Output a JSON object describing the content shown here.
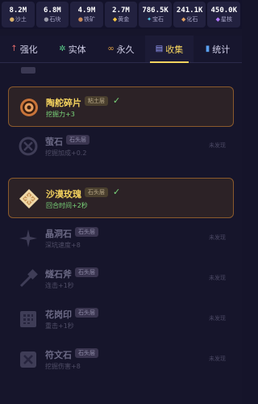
{
  "resources": [
    {
      "value": "8.2M",
      "label": "沙土",
      "icon_name": "sand-icon",
      "icon": "●",
      "color": "#d8b06a"
    },
    {
      "value": "6.8M",
      "label": "石块",
      "icon_name": "stone-icon",
      "icon": "●",
      "color": "#9a9aa8"
    },
    {
      "value": "4.9M",
      "label": "铁矿",
      "icon_name": "iron-ore-icon",
      "icon": "●",
      "color": "#c88a5a"
    },
    {
      "value": "2.7M",
      "label": "黄金",
      "icon_name": "gold-icon",
      "icon": "◆",
      "color": "#f4c542"
    },
    {
      "value": "786.5K",
      "label": "宝石",
      "icon_name": "gem-icon",
      "icon": "✦",
      "color": "#5ad0f0"
    },
    {
      "value": "241.1K",
      "label": "化石",
      "icon_name": "fossil-icon",
      "icon": "◆",
      "color": "#e0a060"
    },
    {
      "value": "450.0K",
      "label": "星核",
      "icon_name": "star-core-icon",
      "icon": "◆",
      "color": "#b478ff"
    }
  ],
  "tabs": [
    {
      "label": "强化",
      "icon": "↑",
      "icon_name": "upgrade-arrow-icon",
      "icon_color": "#e06a6a",
      "active": false
    },
    {
      "label": "实体",
      "icon": "✲",
      "icon_name": "entity-gear-icon",
      "icon_color": "#5ad08a",
      "active": false
    },
    {
      "label": "永久",
      "icon": "∞",
      "icon_name": "infinity-icon",
      "icon_color": "#e0a040",
      "active": false
    },
    {
      "label": "收集",
      "icon": "▤",
      "icon_name": "collection-book-icon",
      "icon_color": "#9aa0ff",
      "active": true
    },
    {
      "label": "统计",
      "icon": "▮",
      "icon_name": "stats-chart-icon",
      "icon_color": "#5aa0f0",
      "active": false
    }
  ],
  "items": [
    {
      "name": "陶舵碎片",
      "tag": "粘土层",
      "desc": "挖掘力+3",
      "found": true,
      "check": "✓",
      "status": "",
      "icon_name": "pottery-shard-icon"
    },
    {
      "name": "萤石",
      "tag": "石头层",
      "desc": "挖掘加成+0.2",
      "found": false,
      "check": "",
      "status": "未发现",
      "icon_name": "fluorite-icon"
    },
    {
      "name": "沙漠玫瑰",
      "tag": "石头层",
      "desc": "回合时间+2秒",
      "found": true,
      "check": "✓",
      "status": "",
      "icon_name": "desert-rose-icon"
    },
    {
      "name": "晶洞石",
      "tag": "石头层",
      "desc": "深坑速度+8",
      "found": false,
      "check": "",
      "status": "未发现",
      "icon_name": "geode-icon"
    },
    {
      "name": "燧石斧",
      "tag": "石头层",
      "desc": "连击+1秒",
      "found": false,
      "check": "",
      "status": "未发现",
      "icon_name": "flint-axe-icon"
    },
    {
      "name": "花岗印",
      "tag": "石头层",
      "desc": "重击+1秒",
      "found": false,
      "check": "",
      "status": "未发现",
      "icon_name": "granite-seal-icon"
    },
    {
      "name": "符文石",
      "tag": "石头层",
      "desc": "挖掘伤害+8",
      "found": false,
      "check": "",
      "status": "未发现",
      "icon_name": "rune-stone-icon"
    }
  ]
}
